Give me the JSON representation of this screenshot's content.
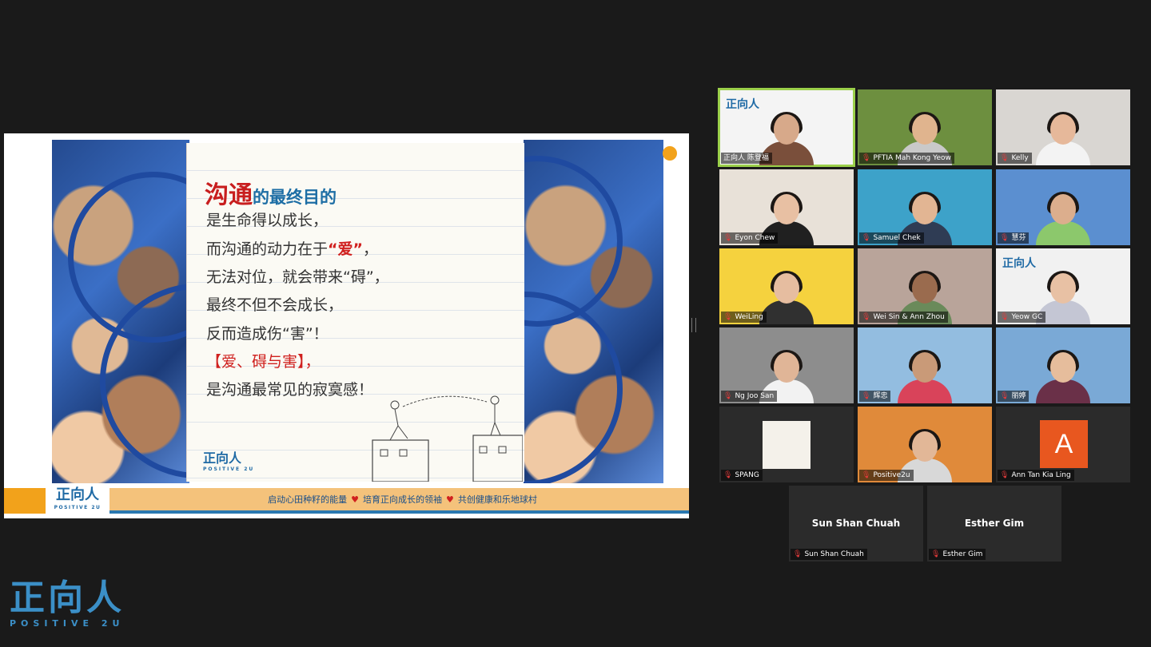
{
  "slide": {
    "title_big": "沟通",
    "title_rest": "的最终目的",
    "lines": [
      {
        "pre": "是生命得以成长，",
        "quote": "",
        "post": ""
      },
      {
        "pre": "而沟通的动力在于",
        "quote": "“爱”",
        "post": "，"
      },
      {
        "pre": "无法对位，就会带来“碍”，",
        "quote": "",
        "post": ""
      },
      {
        "pre": "最终不但不会成长，",
        "quote": "",
        "post": ""
      },
      {
        "pre": "反而造成伤“害”！",
        "quote": "",
        "post": ""
      },
      {
        "pre": "【爱、碍与害】，",
        "quote": "",
        "post": ""
      },
      {
        "pre": "是沟通最常见的寂寞感！",
        "quote": "",
        "post": ""
      }
    ],
    "notebook_logo_cn": "正向人",
    "notebook_logo_en": "POSITIVE 2U",
    "banner_logo_cn": "正向人",
    "banner_logo_en": "POSITIVE 2U",
    "banner_parts": [
      "启动心田种籽的能量",
      "培育正向成长的领袖",
      "共创健康和乐地球村"
    ],
    "heart": "♥"
  },
  "participants": [
    {
      "name": "正向人  陈登福",
      "active": true,
      "muted": false,
      "bg": "#f4f4f4",
      "skin": "#d7a98a",
      "shirt": "#7a4f3b",
      "logo": "正向人"
    },
    {
      "name": "PFTIA Mah Kong Yeow",
      "active": false,
      "muted": true,
      "bg": "#6d8f3f",
      "skin": "#e0b48e",
      "shirt": "#c9c9c9"
    },
    {
      "name": "Kelly",
      "active": false,
      "muted": true,
      "bg": "#d9d6d2",
      "skin": "#e6b89a",
      "shirt": "#f3f3f3"
    },
    {
      "name": "Eyon Chew",
      "active": false,
      "muted": true,
      "bg": "#e8e1d8",
      "skin": "#e8c0a3",
      "shirt": "#202020"
    },
    {
      "name": "Samuel Chek",
      "active": false,
      "muted": true,
      "bg": "#3da2c9",
      "skin": "#e2b593",
      "shirt": "#2f3c54"
    },
    {
      "name": "慧芬",
      "active": false,
      "muted": true,
      "bg": "#5b8fd0",
      "skin": "#dcae8d",
      "shirt": "#8cc86c"
    },
    {
      "name": "WeiLing",
      "active": false,
      "muted": true,
      "bg": "#f5d23e",
      "skin": "#e6bda0",
      "shirt": "#303030"
    },
    {
      "name": "Wei Sin & Ann Zhou",
      "active": false,
      "muted": true,
      "bg": "#b9a49a",
      "skin": "#9a6b4e",
      "shirt": "#6a8a5a"
    },
    {
      "name": "Yeow GC",
      "active": false,
      "muted": true,
      "bg": "#f1f1f1",
      "skin": "#e8c1a4",
      "shirt": "#c4c6d4",
      "logo": "正向人"
    },
    {
      "name": "Ng Joo San",
      "active": false,
      "muted": true,
      "bg": "#8d8d8d",
      "skin": "#e0b597",
      "shirt": "#f2f2f2"
    },
    {
      "name": "辉忠",
      "active": false,
      "muted": true,
      "bg": "#93bde0",
      "skin": "#c99a78",
      "shirt": "#d9435a"
    },
    {
      "name": "丽婷",
      "active": false,
      "muted": true,
      "bg": "#7aa9d6",
      "skin": "#e6bd9c",
      "shirt": "#6a3048"
    },
    {
      "name": "SPANG",
      "active": false,
      "muted": true,
      "bg": "#2b2b2b",
      "skin": "",
      "shirt": "",
      "picture": "card"
    },
    {
      "name": "Positive2u",
      "active": false,
      "muted": true,
      "bg": "#e08a3a",
      "skin": "#e2b797",
      "shirt": "#d8d8d8"
    },
    {
      "name": "Ann Tan Kia Ling",
      "active": false,
      "muted": true,
      "bg": "#2b2b2b",
      "skin": "",
      "shirt": "",
      "avatar": "A"
    },
    {
      "name": "Sun Shan Chuah",
      "active": false,
      "muted": true,
      "bg": "#2b2b2b",
      "center_name": "Sun Shan Chuah"
    },
    {
      "name": "Esther Gim",
      "active": false,
      "muted": true,
      "bg": "#2b2b2b",
      "center_name": "Esther Gim"
    }
  ],
  "brand": {
    "cn": "正向人",
    "en": "POSITIVE 2U"
  }
}
